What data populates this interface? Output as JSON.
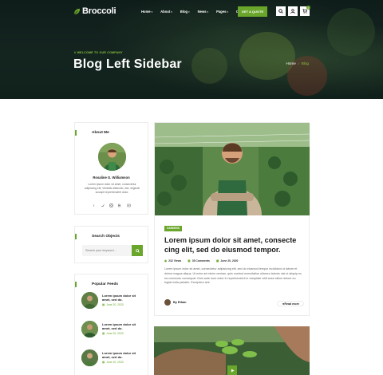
{
  "nav": {
    "logo": "Broccoli",
    "menu": [
      {
        "label": "Home",
        "caret": true
      },
      {
        "label": "About",
        "caret": true
      },
      {
        "label": "Blog",
        "caret": true
      },
      {
        "label": "News",
        "caret": true
      },
      {
        "label": "Pages",
        "caret": true
      },
      {
        "label": "Contact",
        "caret": false
      }
    ],
    "cta": "GET A QUOTE",
    "cart_count": "0",
    "icons": [
      "search-icon",
      "user-icon",
      "cart-icon"
    ]
  },
  "hero": {
    "tagline": "// WELCOME TO OUR COMPANY",
    "title": "Blog Left Sidebar",
    "breadcrumb": {
      "home": "Home",
      "separator": "/",
      "current": "Blog"
    }
  },
  "sidebar": {
    "about": {
      "title": "About Me",
      "name": "Rosaline G. Williamson",
      "text": "Lorem ipsum dolor sit amet, consectetur adipiscing elit, Veritatis distinctio, iste, eligendi suscipit reprehenderit dolor.",
      "socials": [
        "facebook-icon",
        "twitter-icon",
        "instagram-icon",
        "behance-icon",
        "youtube-icon"
      ]
    },
    "search": {
      "title": "Search Objects",
      "placeholder": "Search your keyword..."
    },
    "feeds": {
      "title": "Popular Feeds",
      "items": [
        {
          "title": "Lorem ipsum dolor sit amet, sed do.",
          "date": "June 20, 2020"
        },
        {
          "title": "Lorem ipsum dolor sit amet, sed do.",
          "date": "June 20, 2020"
        },
        {
          "title": "Lorem ipsum dolor sit amet, sed do.",
          "date": "June 20, 2020"
        }
      ]
    }
  },
  "post": {
    "category": "GARDENS",
    "title": "Lorem ipsum dolor sit amet, consecte cing elit, sed do eiusmod tempor.",
    "meta": {
      "views": "232 Views",
      "comments": "35 Comments",
      "date": "June 20, 2020"
    },
    "excerpt": "Lorem ipsum dolor sit amet, consectetur adipisicing elit, sed do eiusmod tempor incididunt ut labore et dolore magna aliqua. Ut enim ad minim veniam, quis nostrud exercitation ullamco laboris nisi ut aliquip ex ea commodo consequat. Duis aute irure dolor in reprehenderit in voluptate velit esse cillum dolore eu fugiat nulla pariatur. Excepteur sint",
    "author": "By Ethan",
    "read_more": "Read more"
  },
  "colors": {
    "accent": "#6aa62b",
    "hero_bg": "#10201b",
    "text": "#1a1a1a"
  }
}
